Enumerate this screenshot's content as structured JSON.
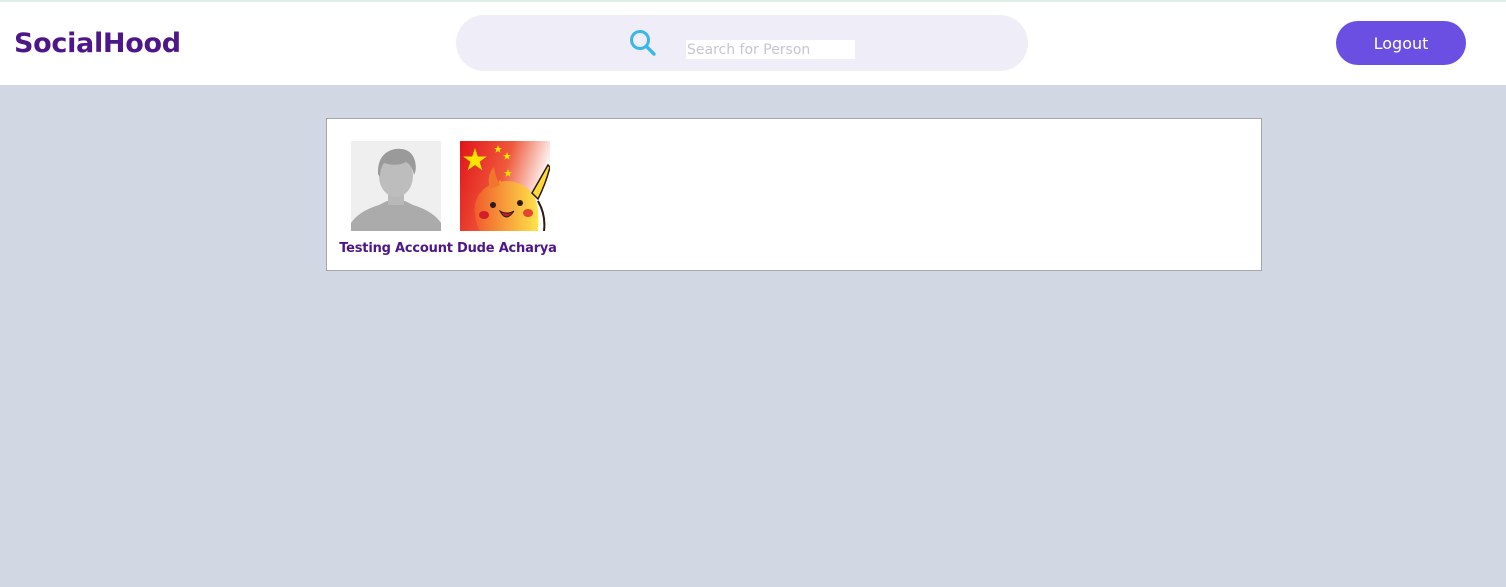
{
  "header": {
    "brand": "SocialHood",
    "search": {
      "placeholder": "Search for Person",
      "value": "",
      "icon": "search-icon"
    },
    "logout_label": "Logout"
  },
  "colors": {
    "brand": "#4d1689",
    "accent": "#6b4fe2",
    "page_background": "#d1d8e3",
    "search_background": "#efedf7",
    "search_icon": "#3bb6ec"
  },
  "results": [
    {
      "name": "Testing Account",
      "avatar": "default-person-avatar"
    },
    {
      "name": "Dude Acharya",
      "avatar": "pikachu-flag-avatar"
    }
  ]
}
